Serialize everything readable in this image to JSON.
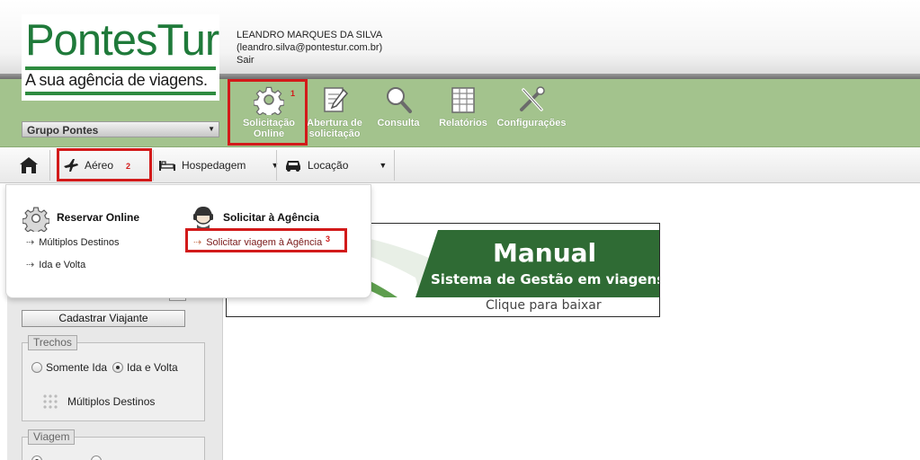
{
  "logo": {
    "name": "PontesTur",
    "tagline": "A sua agência de viagens."
  },
  "user": {
    "name": "LEANDRO MARQUES DA SILVA",
    "email": "(leandro.silva@pontestur.com.br)",
    "logout": "Sair"
  },
  "group_select": {
    "value": "Grupo Pontes"
  },
  "toolbar": {
    "items": [
      {
        "line1": "Solicitação",
        "line2": "Online",
        "icon": "gear-icon"
      },
      {
        "line1": "Abertura de",
        "line2": "solicitação",
        "icon": "edit-document-icon"
      },
      {
        "line1": "Consulta",
        "line2": "",
        "icon": "magnifier-icon"
      },
      {
        "line1": "Relatórios",
        "line2": "",
        "icon": "spreadsheet-icon"
      },
      {
        "line1": "Configurações",
        "line2": "",
        "icon": "tools-icon"
      }
    ]
  },
  "nav": {
    "home_icon": "house-icon",
    "items": [
      {
        "label": "Aéreo",
        "icon": "airplane-icon"
      },
      {
        "label": "Hospedagem",
        "icon": "bed-icon"
      },
      {
        "label": "Locação",
        "icon": "car-icon"
      }
    ]
  },
  "dropdown": {
    "col1": {
      "title": "Reservar Online",
      "links": [
        "Múltiplos Destinos",
        "Ida e Volta"
      ]
    },
    "col2": {
      "title": "Solicitar à Agência",
      "links": [
        "Solicitar viagem à Agência"
      ]
    }
  },
  "annotations": {
    "n1": "1",
    "n2": "2",
    "n3": "3",
    "color": "#d21a1a"
  },
  "left_panel": {
    "register_button": "Cadastrar Viajante",
    "trechos": {
      "legend": "Trechos",
      "opt1": "Somente Ida",
      "opt2": "Ida e Volta",
      "selected": "Ida e Volta",
      "multi": "Múltiplos Destinos"
    },
    "viagem": {
      "legend": "Viagem"
    }
  },
  "banner": {
    "title": "Manual",
    "subtitle": "Sistema de Gestão em viagens",
    "cta": "Clique para baixar"
  },
  "colors": {
    "brand_green": "#1f7a3a",
    "toolbar_green": "#a3c38d",
    "banner_green": "#2f6b34"
  }
}
